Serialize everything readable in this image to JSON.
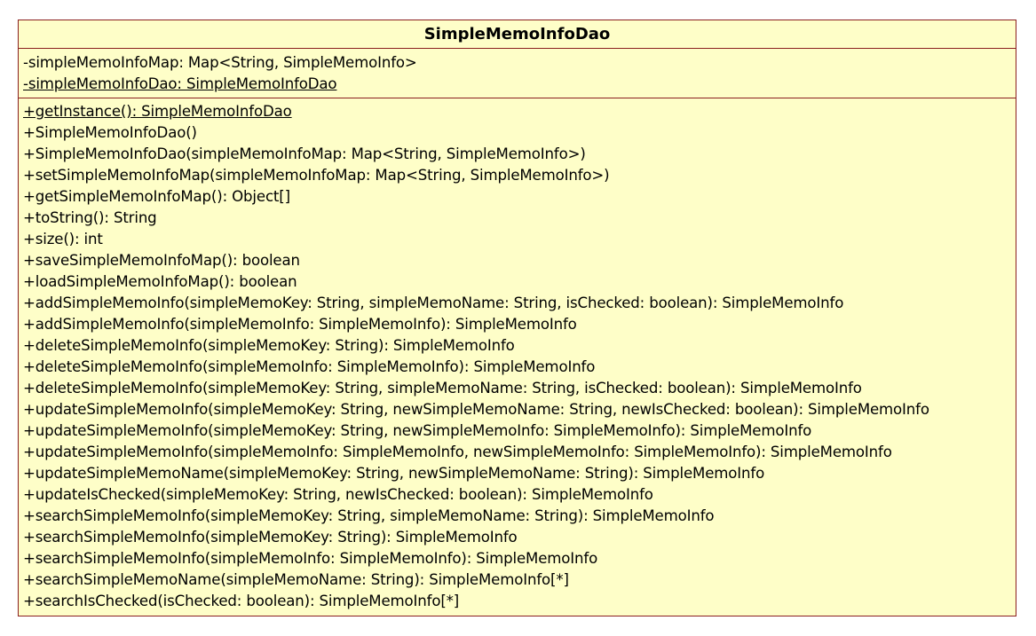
{
  "class": {
    "name": "SimpleMemoInfoDao",
    "attributes": [
      {
        "text": "-simpleMemoInfoMap: Map<String, SimpleMemoInfo>",
        "static": false
      },
      {
        "text": "-simpleMemoInfoDao: SimpleMemoInfoDao",
        "static": true
      }
    ],
    "operations": [
      {
        "text": "+getInstance(): SimpleMemoInfoDao",
        "static": true
      },
      {
        "text": "+SimpleMemoInfoDao()",
        "static": false
      },
      {
        "text": "+SimpleMemoInfoDao(simpleMemoInfoMap: Map<String, SimpleMemoInfo>)",
        "static": false
      },
      {
        "text": "+setSimpleMemoInfoMap(simpleMemoInfoMap: Map<String, SimpleMemoInfo>)",
        "static": false
      },
      {
        "text": "+getSimpleMemoInfoMap(): Object[]",
        "static": false
      },
      {
        "text": "+toString(): String",
        "static": false
      },
      {
        "text": "+size(): int",
        "static": false
      },
      {
        "text": "+saveSimpleMemoInfoMap(): boolean",
        "static": false
      },
      {
        "text": "+loadSimpleMemoInfoMap(): boolean",
        "static": false
      },
      {
        "text": "+addSimpleMemoInfo(simpleMemoKey: String, simpleMemoName: String, isChecked: boolean): SimpleMemoInfo",
        "static": false
      },
      {
        "text": "+addSimpleMemoInfo(simpleMemoInfo: SimpleMemoInfo): SimpleMemoInfo",
        "static": false
      },
      {
        "text": "+deleteSimpleMemoInfo(simpleMemoKey: String): SimpleMemoInfo",
        "static": false
      },
      {
        "text": "+deleteSimpleMemoInfo(simpleMemoInfo: SimpleMemoInfo): SimpleMemoInfo",
        "static": false
      },
      {
        "text": "+deleteSimpleMemoInfo(simpleMemoKey: String, simpleMemoName: String, isChecked: boolean): SimpleMemoInfo",
        "static": false
      },
      {
        "text": "+updateSimpleMemoInfo(simpleMemoKey: String, newSimpleMemoName: String, newIsChecked: boolean): SimpleMemoInfo",
        "static": false
      },
      {
        "text": "+updateSimpleMemoInfo(simpleMemoKey: String, newSimpleMemoInfo: SimpleMemoInfo): SimpleMemoInfo",
        "static": false
      },
      {
        "text": "+updateSimpleMemoInfo(simpleMemoInfo: SimpleMemoInfo, newSimpleMemoInfo: SimpleMemoInfo): SimpleMemoInfo",
        "static": false
      },
      {
        "text": "+updateSimpleMemoName(simpleMemoKey: String, newSimpleMemoName: String): SimpleMemoInfo",
        "static": false
      },
      {
        "text": "+updateIsChecked(simpleMemoKey: String, newIsChecked: boolean): SimpleMemoInfo",
        "static": false
      },
      {
        "text": "+searchSimpleMemoInfo(simpleMemoKey: String, simpleMemoName: String): SimpleMemoInfo",
        "static": false
      },
      {
        "text": "+searchSimpleMemoInfo(simpleMemoKey: String): SimpleMemoInfo",
        "static": false
      },
      {
        "text": "+searchSimpleMemoInfo(simpleMemoInfo: SimpleMemoInfo): SimpleMemoInfo",
        "static": false
      },
      {
        "text": "+searchSimpleMemoName(simpleMemoName: String): SimpleMemoInfo[*]",
        "static": false
      },
      {
        "text": "+searchIsChecked(isChecked: boolean): SimpleMemoInfo[*]",
        "static": false
      }
    ]
  },
  "colors": {
    "fill": "#fefec8",
    "border": "#8a1f1f",
    "text": "#000000"
  }
}
